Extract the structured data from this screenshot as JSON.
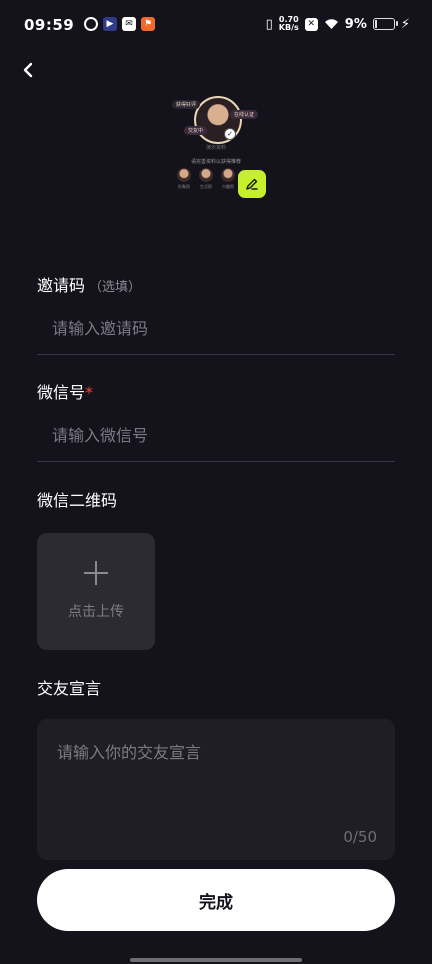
{
  "status_bar": {
    "time": "09:59",
    "net_speed_value": "0.70",
    "net_speed_unit": "KB/s",
    "battery_percent": "9%",
    "icons": [
      "sync-icon",
      "video-icon",
      "mail-icon",
      "app-icon",
      "vibrate-icon",
      "sim-icon",
      "wifi-icon",
      "battery-icon",
      "charging-icon"
    ]
  },
  "profile": {
    "tags": [
      "获得好评",
      "在线认证",
      "交友中"
    ],
    "subtitle": "演示资料",
    "hint": "请完善资料以获得推荐",
    "mini_labels": [
      "形象照",
      "生活照",
      "兴趣照"
    ]
  },
  "form": {
    "invite": {
      "label": "邀请码",
      "optional": "（选填）",
      "placeholder": "请输入邀请码"
    },
    "wechat": {
      "label": "微信号",
      "required_mark": "*",
      "placeholder": "请输入微信号"
    },
    "qrcode": {
      "label": "微信二维码",
      "upload_text": "点击上传"
    },
    "declaration": {
      "label": "交友宣言",
      "placeholder": "请输入你的交友宣言",
      "counter": "0/50"
    }
  },
  "actions": {
    "done_label": "完成"
  },
  "colors": {
    "background": "#14121b",
    "accent": "#c6ef2f",
    "required": "#ff3b30",
    "button_bg": "#ffffff"
  }
}
